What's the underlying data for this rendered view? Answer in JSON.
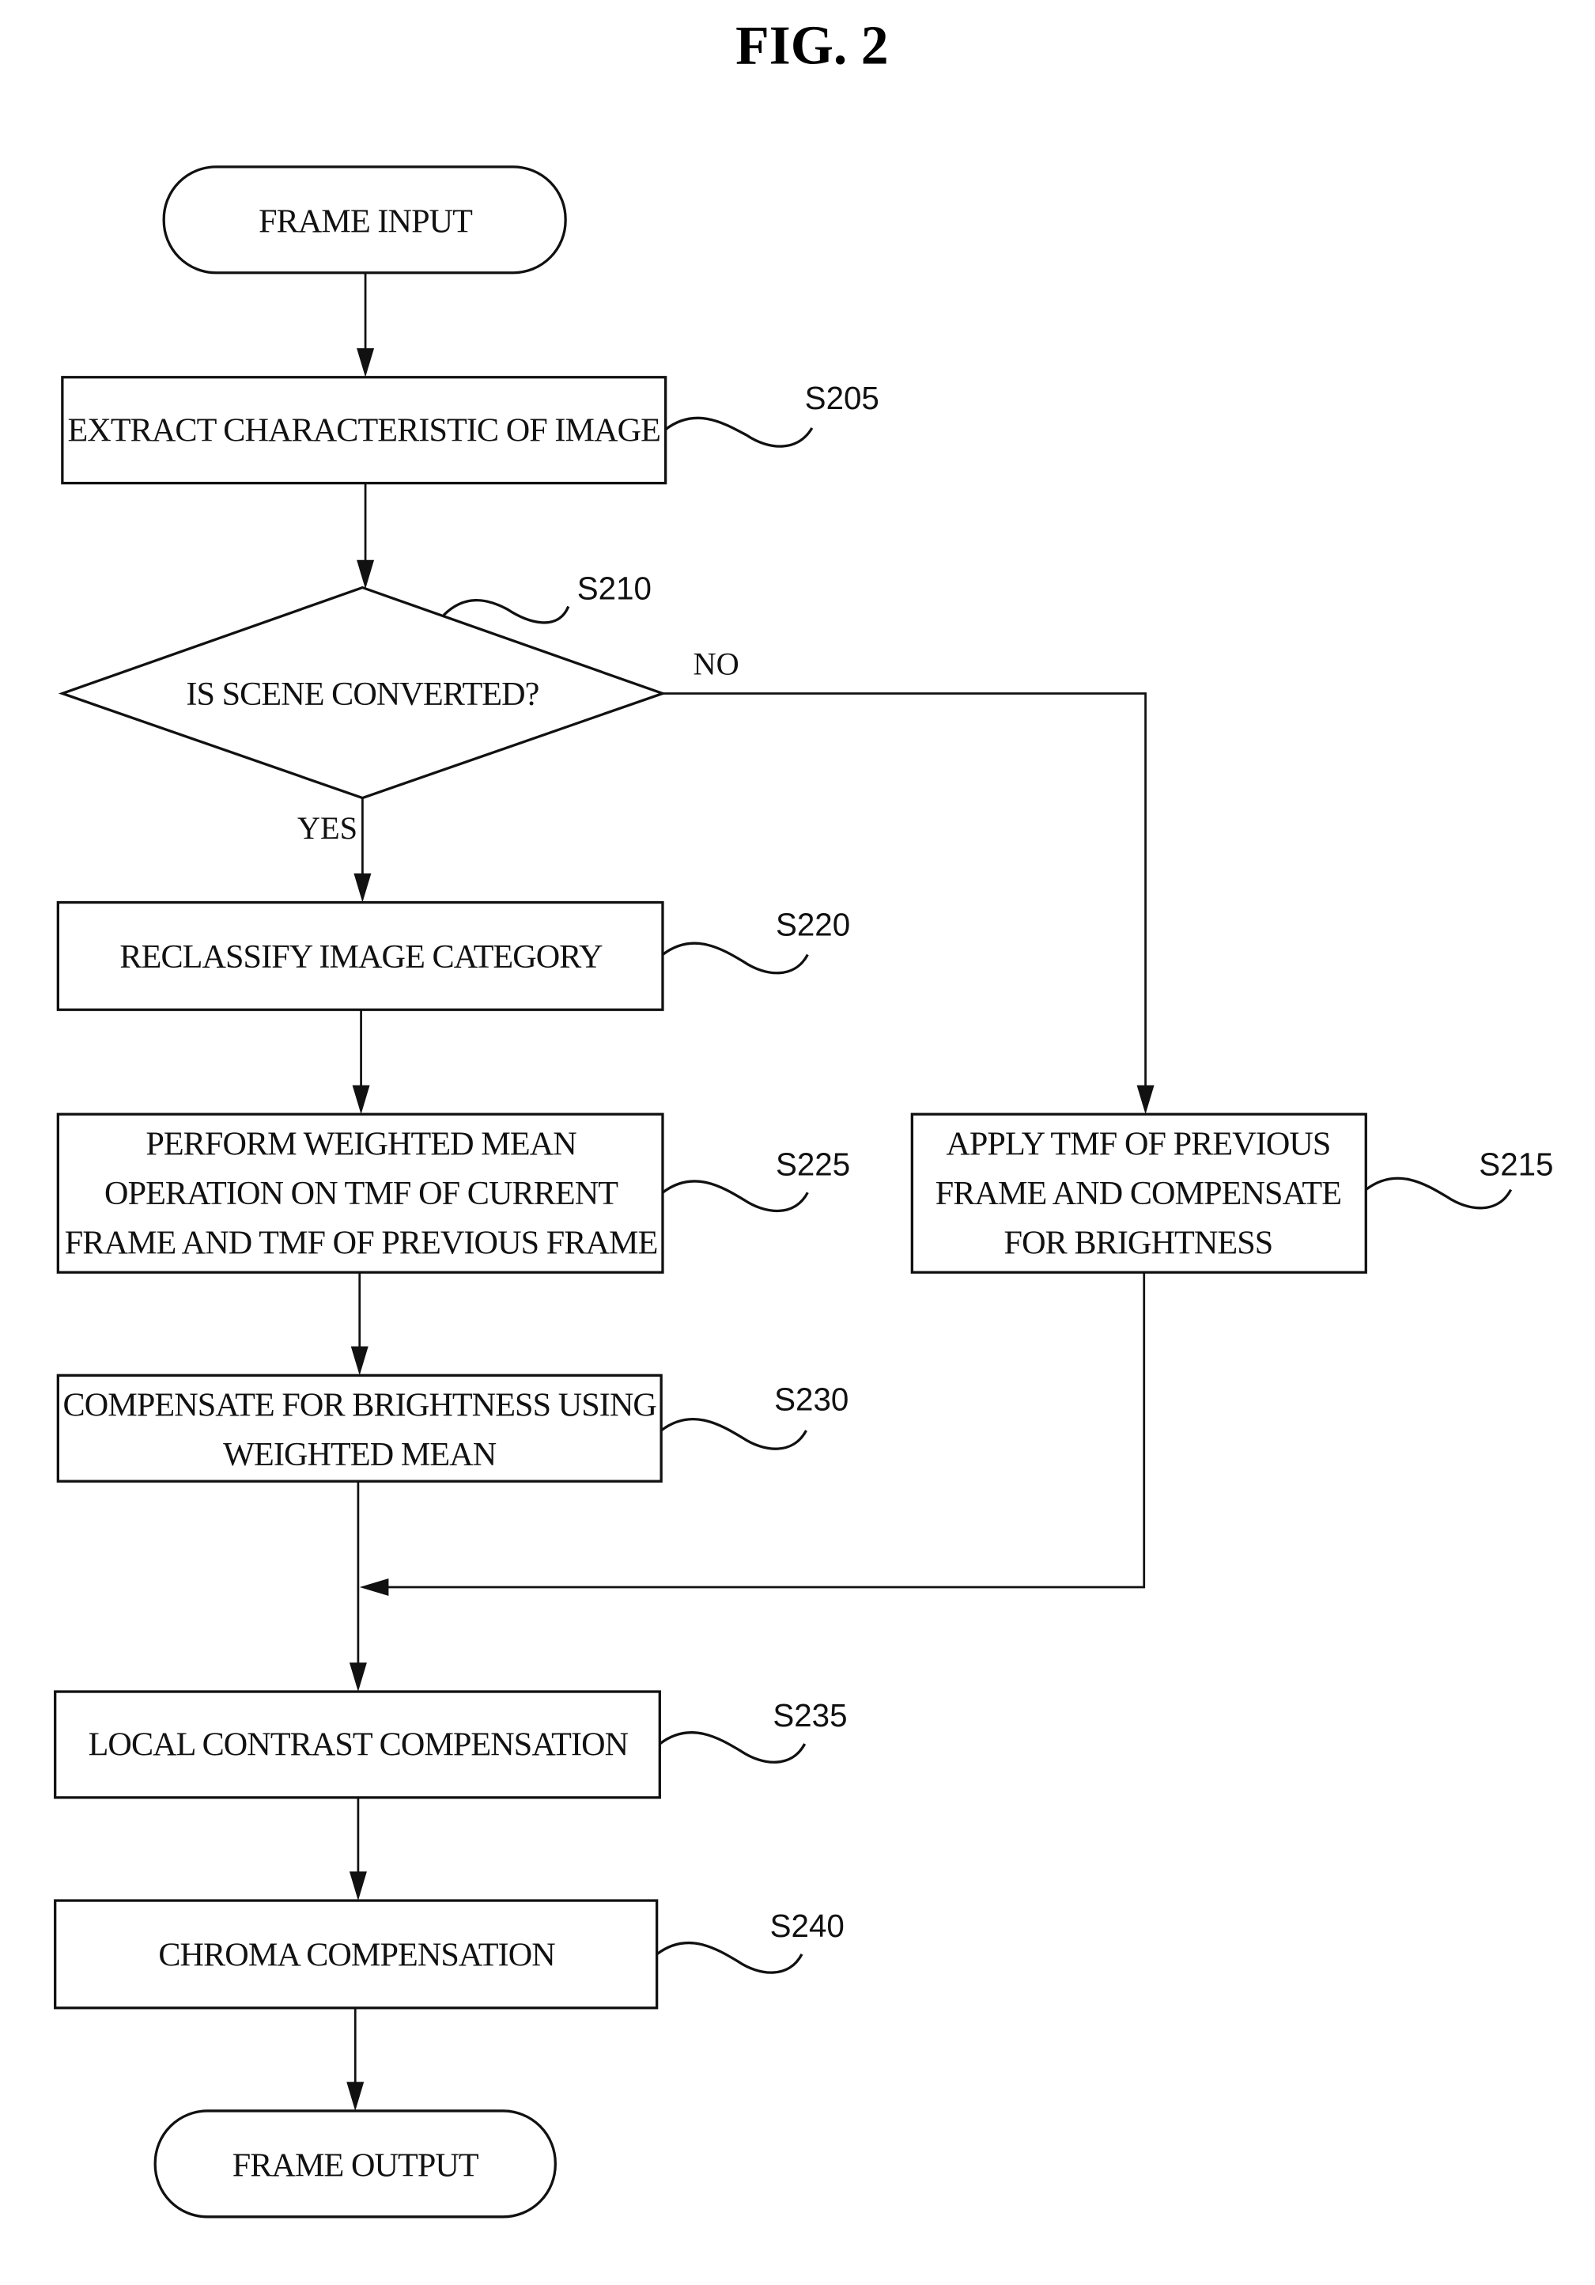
{
  "figure": {
    "title": "FIG. 2"
  },
  "nodes": [
    {
      "id": "start",
      "type": "terminal",
      "lines": [
        "FRAME INPUT"
      ],
      "step": ""
    },
    {
      "id": "s205",
      "type": "process",
      "lines": [
        "EXTRACT CHARACTERISTIC OF IMAGE"
      ],
      "step": "S205"
    },
    {
      "id": "s210",
      "type": "decision",
      "lines": [
        "IS SCENE CONVERTED?"
      ],
      "step": "S210"
    },
    {
      "id": "s220",
      "type": "process",
      "lines": [
        "RECLASSIFY IMAGE CATEGORY"
      ],
      "step": "S220"
    },
    {
      "id": "s225",
      "type": "process",
      "lines": [
        "PERFORM WEIGHTED MEAN",
        "OPERATION ON TMF OF CURRENT",
        "FRAME AND TMF OF PREVIOUS FRAME"
      ],
      "step": "S225"
    },
    {
      "id": "s215",
      "type": "process",
      "lines": [
        "APPLY TMF OF PREVIOUS",
        "FRAME AND COMPENSATE",
        "FOR BRIGHTNESS"
      ],
      "step": "S215"
    },
    {
      "id": "s230",
      "type": "process",
      "lines": [
        "COMPENSATE FOR BRIGHTNESS USING",
        "WEIGHTED MEAN"
      ],
      "step": "S230"
    },
    {
      "id": "s235",
      "type": "process",
      "lines": [
        "LOCAL CONTRAST COMPENSATION"
      ],
      "step": "S235"
    },
    {
      "id": "s240",
      "type": "process",
      "lines": [
        "CHROMA COMPENSATION"
      ],
      "step": "S240"
    },
    {
      "id": "end",
      "type": "terminal",
      "lines": [
        "FRAME OUTPUT"
      ],
      "step": ""
    }
  ],
  "branches": {
    "yes": "YES",
    "no": "NO"
  },
  "edges": [
    {
      "from": "start",
      "to": "s205"
    },
    {
      "from": "s205",
      "to": "s210"
    },
    {
      "from": "s210",
      "to": "s220",
      "label": "YES"
    },
    {
      "from": "s210",
      "to": "s215",
      "label": "NO"
    },
    {
      "from": "s220",
      "to": "s225"
    },
    {
      "from": "s225",
      "to": "s230"
    },
    {
      "from": "s230",
      "to": "s235"
    },
    {
      "from": "s215",
      "to": "s235"
    },
    {
      "from": "s235",
      "to": "s240"
    },
    {
      "from": "s240",
      "to": "end"
    }
  ]
}
